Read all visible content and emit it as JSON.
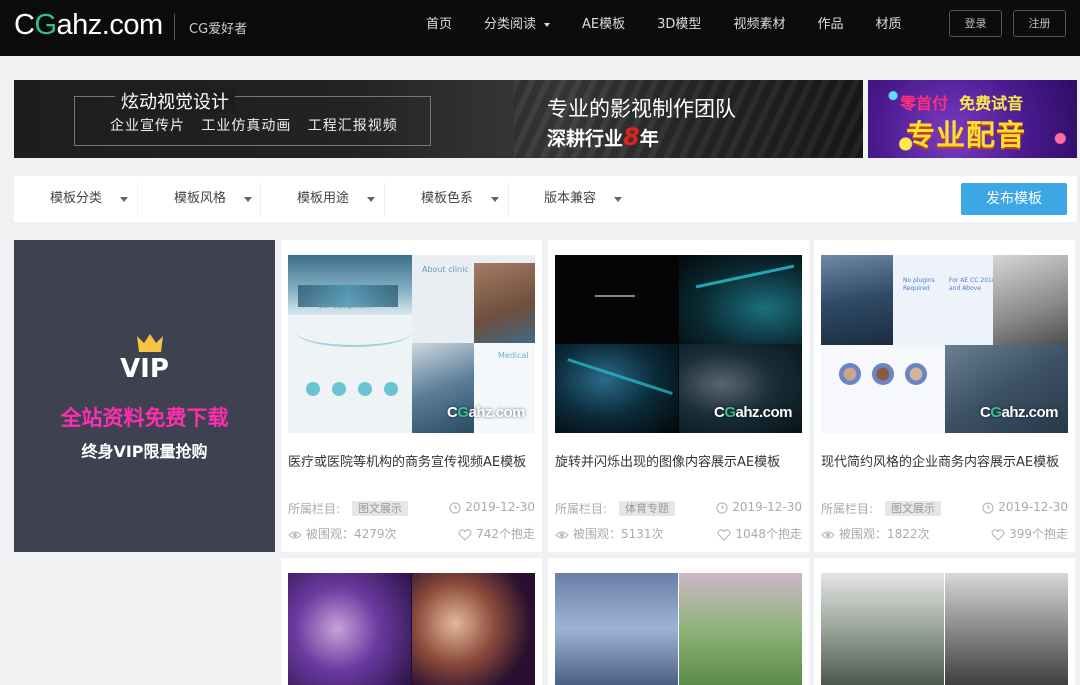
{
  "header": {
    "logo_prefix": "C",
    "logo_g": "G",
    "logo_rest": "ahz.com",
    "logo_sub": "CG爱好者",
    "nav": [
      "首页",
      "分类阅读",
      "AE模板",
      "3D模型",
      "视频素材",
      "作品",
      "材质"
    ],
    "login": "登录",
    "register": "注册"
  },
  "banner_left": {
    "title": "炫动视觉设计",
    "subtitle": "企业宣传片   工业仿真动画   工程汇报视频",
    "right_line1": "专业的影视制作团队",
    "right_line2_a": "深耕行业",
    "right_line2_num": "8",
    "right_line2_b": "年"
  },
  "banner_right": {
    "top_a": "零首付",
    "top_b": "免费试音",
    "main": "专业配音"
  },
  "filters": [
    "模板分类",
    "模板风格",
    "模板用途",
    "模板色系",
    "版本兼容"
  ],
  "publish_button": "发布模板",
  "vip": {
    "label": "VIP",
    "free": "全站资料免费下载",
    "limit": "终身VIP限量抢购"
  },
  "watermark": {
    "c": "C",
    "g": "G",
    "rest": "ahz.com"
  },
  "cards": [
    {
      "title": "医疗或医院等机构的商务宣传视频AE模板",
      "col_label": "所属栏目:",
      "tag": "图文展示",
      "date": "2019-12-30",
      "views": "被围观：4279次",
      "likes": "742个抱走"
    },
    {
      "title": "旋转并闪烁出现的图像内容展示AE模板",
      "col_label": "所属栏目:",
      "tag": "体育专题",
      "date": "2019-12-30",
      "views": "被围观：5131次",
      "likes": "1048个抱走"
    },
    {
      "title": "现代简约风格的企业商务内容展示AE模板",
      "col_label": "所属栏目:",
      "tag": "图文展示",
      "date": "2019-12-30",
      "views": "被围观：1822次",
      "likes": "399个抱走"
    }
  ],
  "colors": {
    "accent": "#3da7e6",
    "brand_green": "#2fc28f",
    "vip_pink": "#ff2eae",
    "vip_bg": "#3e4150",
    "header_bg": "#0c0c0c"
  }
}
